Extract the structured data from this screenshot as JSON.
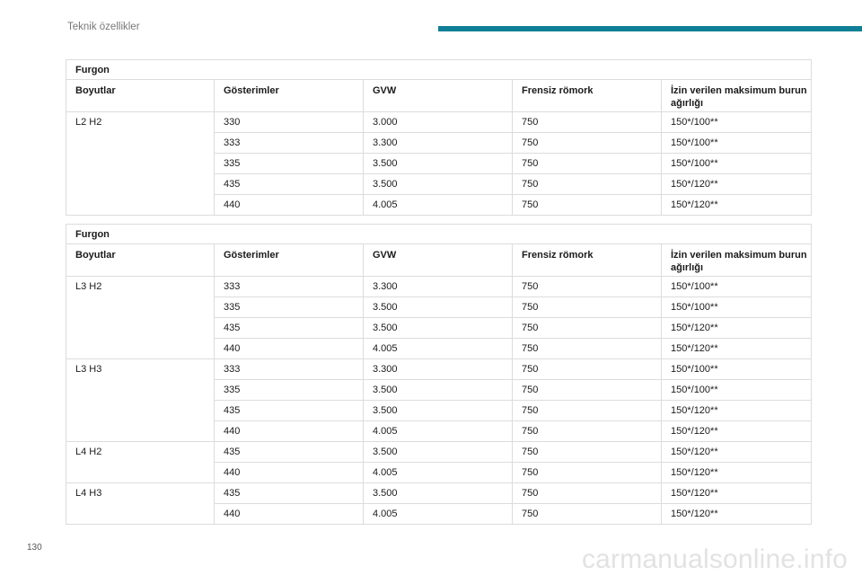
{
  "header": {
    "title": "Teknik özellikler"
  },
  "page_number": "130",
  "watermark": "carmanualsonline.info",
  "tables": [
    {
      "title": "Furgon",
      "columns": [
        "Boyutlar",
        "Gösterimler",
        "GVW",
        "Frensiz römork",
        "İzin verilen maksimum burun ağırlığı"
      ],
      "groups": [
        {
          "dimension": "L2 H2",
          "rows": [
            [
              "330",
              "3.000",
              "750",
              "150*/100**"
            ],
            [
              "333",
              "3.300",
              "750",
              "150*/100**"
            ],
            [
              "335",
              "3.500",
              "750",
              "150*/100**"
            ],
            [
              "435",
              "3.500",
              "750",
              "150*/120**"
            ],
            [
              "440",
              "4.005",
              "750",
              "150*/120**"
            ]
          ]
        }
      ]
    },
    {
      "title": "Furgon",
      "columns": [
        "Boyutlar",
        "Gösterimler",
        "GVW",
        "Frensiz römork",
        "İzin verilen maksimum burun ağırlığı"
      ],
      "groups": [
        {
          "dimension": "L3 H2",
          "rows": [
            [
              "333",
              "3.300",
              "750",
              "150*/100**"
            ],
            [
              "335",
              "3.500",
              "750",
              "150*/100**"
            ],
            [
              "435",
              "3.500",
              "750",
              "150*/120**"
            ],
            [
              "440",
              "4.005",
              "750",
              "150*/120**"
            ]
          ]
        },
        {
          "dimension": "L3 H3",
          "rows": [
            [
              "333",
              "3.300",
              "750",
              "150*/100**"
            ],
            [
              "335",
              "3.500",
              "750",
              "150*/100**"
            ],
            [
              "435",
              "3.500",
              "750",
              "150*/120**"
            ],
            [
              "440",
              "4.005",
              "750",
              "150*/120**"
            ]
          ]
        },
        {
          "dimension": "L4 H2",
          "rows": [
            [
              "435",
              "3.500",
              "750",
              "150*/120**"
            ],
            [
              "440",
              "4.005",
              "750",
              "150*/120**"
            ]
          ]
        },
        {
          "dimension": "L4 H3",
          "rows": [
            [
              "435",
              "3.500",
              "750",
              "150*/120**"
            ],
            [
              "440",
              "4.005",
              "750",
              "150*/120**"
            ]
          ]
        }
      ]
    }
  ]
}
